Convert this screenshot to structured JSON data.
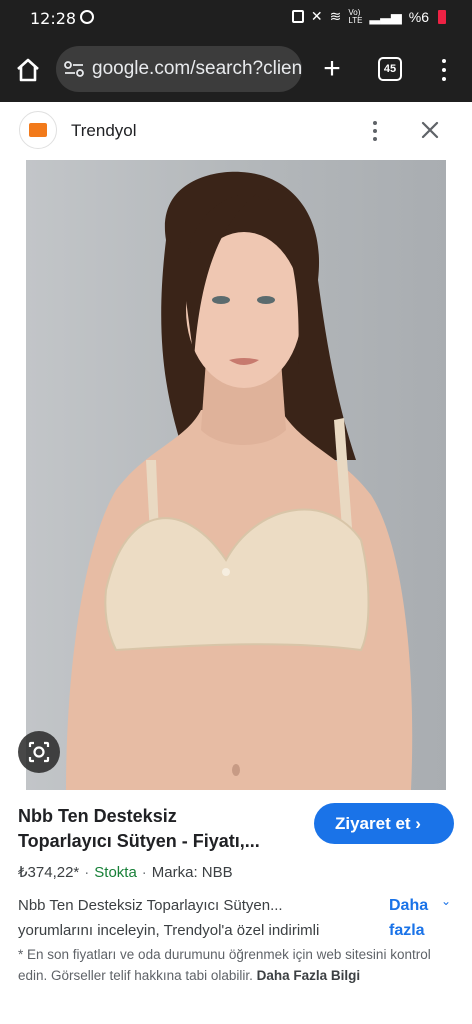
{
  "status_bar": {
    "time": "12:28",
    "network_label": "Vo)\nLTE",
    "battery": "%6"
  },
  "browser": {
    "url": "google.com/search?client",
    "tab_count": "45"
  },
  "panel": {
    "site_name": "Trendyol"
  },
  "product": {
    "title_line1": "Nbb Ten Desteksiz",
    "title_line2": "Toparlayıcı Sütyen - Fiyatı,...",
    "visit_label": "Ziyaret et ›",
    "price": "₺374,22*",
    "stock": "Stokta",
    "brand": "Marka: NBB",
    "desc_line1": "Nbb Ten Desteksiz Toparlayıcı Sütyen...",
    "desc_line2": "yorumlarını inceleyin, Trendyol'a özel indirimli",
    "more_line1": "Daha",
    "more_line2": "fazla",
    "disclaimer": "* En son fiyatları ve oda durumunu öğrenmek için web sitesini kontrol edin. Görseller telif hakkına tabi olabilir.",
    "disclaimer_link": "Daha Fazla Bilgi"
  },
  "colors": {
    "accent": "#1a73e8",
    "stock_green": "#188038",
    "trendyol_orange": "#f27a1a"
  }
}
